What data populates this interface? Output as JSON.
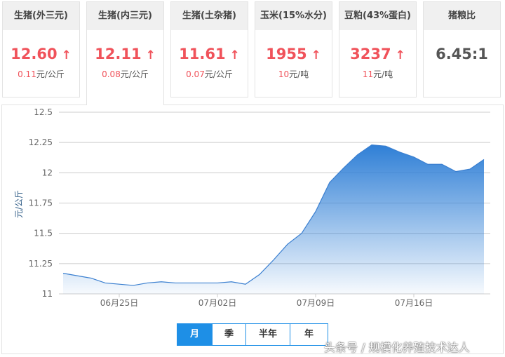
{
  "cards": [
    {
      "title": "生猪(外三元)",
      "value": "12.60",
      "change": "0.11",
      "unit": "元/公斤"
    },
    {
      "title": "生猪(内三元)",
      "value": "12.11",
      "change": "0.08",
      "unit": "元/公斤"
    },
    {
      "title": "生猪(土杂猪)",
      "value": "11.61",
      "change": "0.07",
      "unit": "元/公斤"
    },
    {
      "title": "玉米(15%水分)",
      "value": "1955",
      "change": "10",
      "unit": "元/吨"
    },
    {
      "title": "豆粕(43%蛋白)",
      "value": "3237",
      "change": "11",
      "unit": "元/吨"
    },
    {
      "title": "猪粮比",
      "value": "6.45:1"
    }
  ],
  "arrow": "↑",
  "range_buttons": [
    "月",
    "季",
    "半年",
    "年"
  ],
  "watermark": "头条号 / 规模化养殖技术达人",
  "colors": {
    "accent": "#1e8fe6",
    "up": "#f0525a",
    "area_top": "#2f7fd6"
  },
  "chart_data": {
    "type": "area",
    "ylabel": "元/公斤",
    "ylim": [
      11,
      12.5
    ],
    "yticks": [
      "11",
      "11.25",
      "11.5",
      "11.75",
      "12",
      "12.25",
      "12.5"
    ],
    "xticks": [
      {
        "label": "06月25日",
        "index": 4
      },
      {
        "label": "07月02日",
        "index": 11
      },
      {
        "label": "07月09日",
        "index": 18
      },
      {
        "label": "07月16日",
        "index": 25
      }
    ],
    "values": [
      11.17,
      11.15,
      11.13,
      11.09,
      11.08,
      11.07,
      11.09,
      11.1,
      11.09,
      11.09,
      11.09,
      11.09,
      11.1,
      11.08,
      11.16,
      11.28,
      11.41,
      11.5,
      11.68,
      11.92,
      12.04,
      12.15,
      12.23,
      12.22,
      12.17,
      12.13,
      12.07,
      12.07,
      12.01,
      12.03,
      12.11
    ]
  }
}
